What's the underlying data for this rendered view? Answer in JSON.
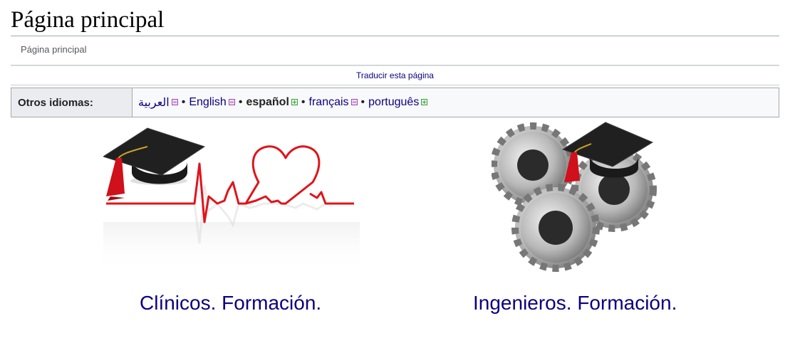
{
  "page": {
    "title": "Página principal",
    "breadcrumb": "Página principal",
    "translate_link": "Traducir esta página"
  },
  "languages": {
    "header": "Otros idiomas:",
    "items": [
      {
        "label": "العربية",
        "status": "partial",
        "current": false
      },
      {
        "label": "English",
        "status": "partial",
        "current": false
      },
      {
        "label": "español",
        "status": "complete",
        "current": true
      },
      {
        "label": "français",
        "status": "partial",
        "current": false
      },
      {
        "label": "português",
        "status": "complete",
        "current": false
      }
    ],
    "separator": "•"
  },
  "cards": [
    {
      "label": "Clínicos. Formación.",
      "image": "graduation-cap-heartbeat-image"
    },
    {
      "label": "Ingenieros. Formación.",
      "image": "graduation-cap-gears-image"
    }
  ],
  "colors": {
    "link": "#0b0080",
    "heartbeat": "#e0141b",
    "cap": "#1a1a1a",
    "tassel": "#d0101a",
    "gear": "#9a9a9a"
  }
}
